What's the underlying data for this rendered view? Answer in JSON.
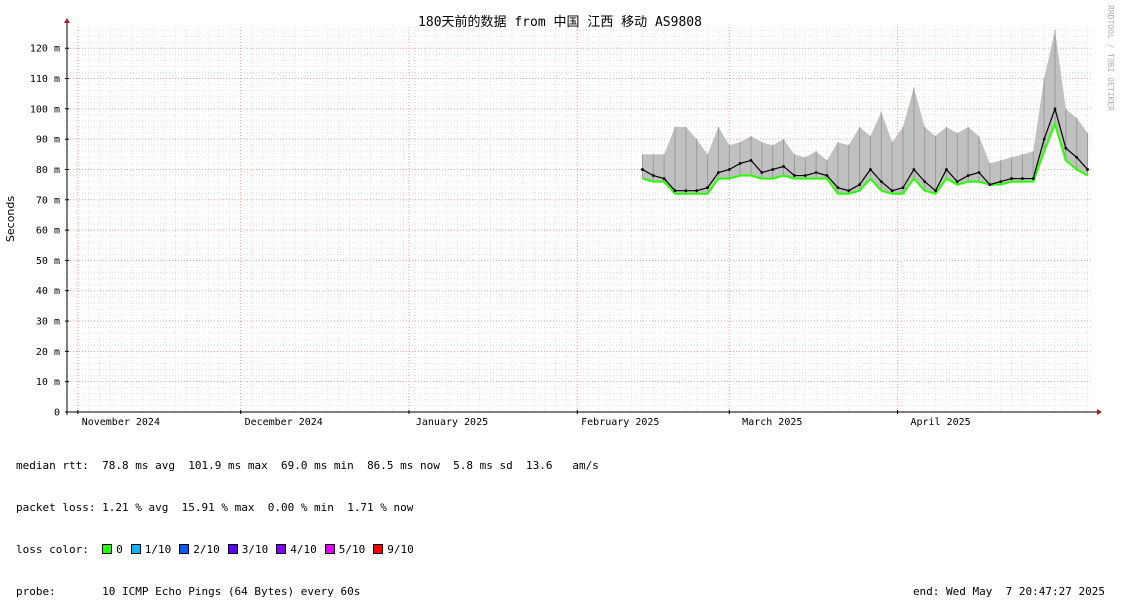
{
  "colors": {
    "loss_0": "#26ff00",
    "loss_1": "#00b8ff",
    "loss_2": "#0059ff",
    "loss_3": "#5e00ff",
    "loss_4": "#7e00ff",
    "loss_5": "#dd00ff",
    "loss_9": "#ff0000",
    "smoke": "#c0c0c0",
    "median": "#000000"
  },
  "chart_data": {
    "type": "line",
    "title": "180天前的数据 from 中国 江西 移动 AS9808",
    "xlabel": "",
    "ylabel": "Seconds",
    "watermark": "RRDTOOL / TOBI OETIKER",
    "ylim": [
      0,
      127
    ],
    "y_ticks": [
      {
        "value": 0,
        "label": "0"
      },
      {
        "value": 10,
        "label": "10 m"
      },
      {
        "value": 20,
        "label": "20 m"
      },
      {
        "value": 30,
        "label": "30 m"
      },
      {
        "value": 40,
        "label": "40 m"
      },
      {
        "value": 50,
        "label": "50 m"
      },
      {
        "value": 60,
        "label": "60 m"
      },
      {
        "value": 70,
        "label": "70 m"
      },
      {
        "value": 80,
        "label": "80 m"
      },
      {
        "value": 90,
        "label": "90 m"
      },
      {
        "value": 100,
        "label": "100 m"
      },
      {
        "value": 110,
        "label": "110 m"
      },
      {
        "value": 120,
        "label": "120 m"
      }
    ],
    "xlim": [
      "2024-10-30",
      "2025-05-07"
    ],
    "x_ticks": [
      {
        "date": "2024-11-01",
        "label": "November 2024"
      },
      {
        "date": "2024-12-01",
        "label": "December 2024"
      },
      {
        "date": "2025-01-01",
        "label": "January 2025"
      },
      {
        "date": "2025-02-01",
        "label": "February 2025"
      },
      {
        "date": "2025-03-01",
        "label": "March 2025"
      },
      {
        "date": "2025-04-01",
        "label": "April 2025"
      }
    ],
    "grid": true,
    "series": [
      {
        "name": "median rtt",
        "x": [
          "2025-02-13",
          "2025-02-15",
          "2025-02-17",
          "2025-02-19",
          "2025-02-21",
          "2025-02-23",
          "2025-02-25",
          "2025-02-27",
          "2025-03-01",
          "2025-03-03",
          "2025-03-05",
          "2025-03-07",
          "2025-03-09",
          "2025-03-11",
          "2025-03-13",
          "2025-03-15",
          "2025-03-17",
          "2025-03-19",
          "2025-03-21",
          "2025-03-23",
          "2025-03-25",
          "2025-03-27",
          "2025-03-29",
          "2025-03-31",
          "2025-04-02",
          "2025-04-04",
          "2025-04-06",
          "2025-04-08",
          "2025-04-10",
          "2025-04-12",
          "2025-04-14",
          "2025-04-16",
          "2025-04-18",
          "2025-04-20",
          "2025-04-22",
          "2025-04-24",
          "2025-04-26",
          "2025-04-28",
          "2025-04-30",
          "2025-05-02",
          "2025-05-04",
          "2025-05-06"
        ],
        "y": [
          80,
          78,
          77,
          73,
          73,
          73,
          74,
          79,
          80,
          82,
          83,
          79,
          80,
          81,
          78,
          78,
          79,
          78,
          74,
          73,
          75,
          80,
          76,
          73,
          74,
          80,
          76,
          73,
          80,
          76,
          78,
          79,
          75,
          76,
          77,
          77,
          77,
          90,
          100,
          87,
          84,
          80
        ],
        "low": [
          77,
          76,
          76,
          72,
          72,
          72,
          72,
          77,
          77,
          78,
          78,
          77,
          77,
          78,
          77,
          77,
          77,
          77,
          72,
          72,
          73,
          77,
          73,
          72,
          72,
          77,
          73,
          72,
          77,
          75,
          76,
          76,
          75,
          75,
          76,
          76,
          76,
          86,
          95,
          83,
          80,
          78
        ],
        "high": [
          85,
          85,
          85,
          94,
          94,
          90,
          85,
          94,
          88,
          89,
          91,
          89,
          88,
          90,
          85,
          84,
          86,
          83,
          89,
          88,
          94,
          91,
          99,
          89,
          94,
          107,
          94,
          91,
          94,
          92,
          94,
          91,
          82,
          83,
          84,
          85,
          86,
          110,
          126,
          100,
          97,
          92
        ]
      }
    ]
  },
  "stats": {
    "median_rtt": {
      "label": "median rtt:",
      "avg": "78.8 ms avg",
      "max": "101.9 ms max",
      "min": "69.0 ms min",
      "now": "86.5 ms now",
      "sd": "5.8 ms sd",
      "ams": "13.6   am/s"
    },
    "packet_loss": {
      "label": "packet loss:",
      "avg": "1.21 % avg",
      "max": "15.91 % max",
      "min": "0.00 % min",
      "now": "1.71 % now"
    },
    "loss_color": {
      "label": "loss color:",
      "items": [
        {
          "label": "0",
          "color": "#26ff00"
        },
        {
          "label": "1/10",
          "color": "#00b8ff"
        },
        {
          "label": "2/10",
          "color": "#0059ff"
        },
        {
          "label": "3/10",
          "color": "#5e00ff"
        },
        {
          "label": "4/10",
          "color": "#7e00ff"
        },
        {
          "label": "5/10",
          "color": "#dd00ff"
        },
        {
          "label": "9/10",
          "color": "#ff0000"
        }
      ]
    },
    "probe": {
      "label": "probe:",
      "value": "10 ICMP Echo Pings (64 Bytes) every 60s"
    },
    "end": "end: Wed May  7 20:47:27 2025"
  }
}
